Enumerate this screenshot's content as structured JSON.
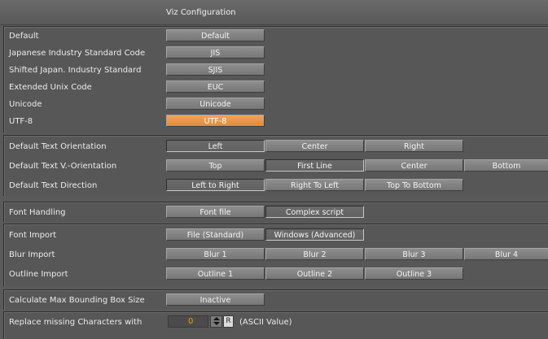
{
  "window": {
    "title": "Viz Configuration"
  },
  "encoding": {
    "rows": [
      {
        "label": "Default",
        "button": "Default"
      },
      {
        "label": "Japanese Industry Standard Code",
        "button": "JIS"
      },
      {
        "label": "Shifted Japan. Industry Standard",
        "button": "SJIS"
      },
      {
        "label": "Extended Unix Code",
        "button": "EUC"
      },
      {
        "label": "Unicode",
        "button": "Unicode"
      },
      {
        "label": "UTF-8",
        "button": "UTF-8",
        "selected": true,
        "highlight": "#e8924a"
      }
    ]
  },
  "text": {
    "orientation": {
      "label": "Default Text Orientation",
      "options": [
        "Left",
        "Center",
        "Right"
      ],
      "selected": 0
    },
    "v_orientation": {
      "label": "Default Text V.-Orientation",
      "options": [
        "Top",
        "First Line",
        "Center",
        "Bottom"
      ],
      "selected": 1
    },
    "direction": {
      "label": "Default Text Direction",
      "options": [
        "Left to Right",
        "Right To Left",
        "Top To Bottom"
      ],
      "selected": 0
    }
  },
  "font_handling": {
    "label": "Font Handling",
    "options": [
      "Font file",
      "Complex script"
    ],
    "selected": 1
  },
  "import": {
    "font": {
      "label": "Font Import",
      "options": [
        "File (Standard)",
        "Windows (Advanced)"
      ],
      "selected": 1
    },
    "blur": {
      "label": "Blur Import",
      "options": [
        "Blur 1",
        "Blur 2",
        "Blur 3",
        "Blur 4"
      ],
      "selected": -1
    },
    "outline": {
      "label": "Outline Import",
      "options": [
        "Outline 1",
        "Outline 2",
        "Outline 3"
      ],
      "selected": -1
    }
  },
  "bounding_box": {
    "label": "Calculate Max Bounding Box Size",
    "button": "Inactive"
  },
  "replace_missing": {
    "label": "Replace missing Characters with",
    "value": "0",
    "reset_label": "R",
    "suffix": "(ASCII Value)"
  },
  "colors": {
    "accent": "#e8924a",
    "panel": "#575757",
    "value_text": "#f5a100"
  }
}
